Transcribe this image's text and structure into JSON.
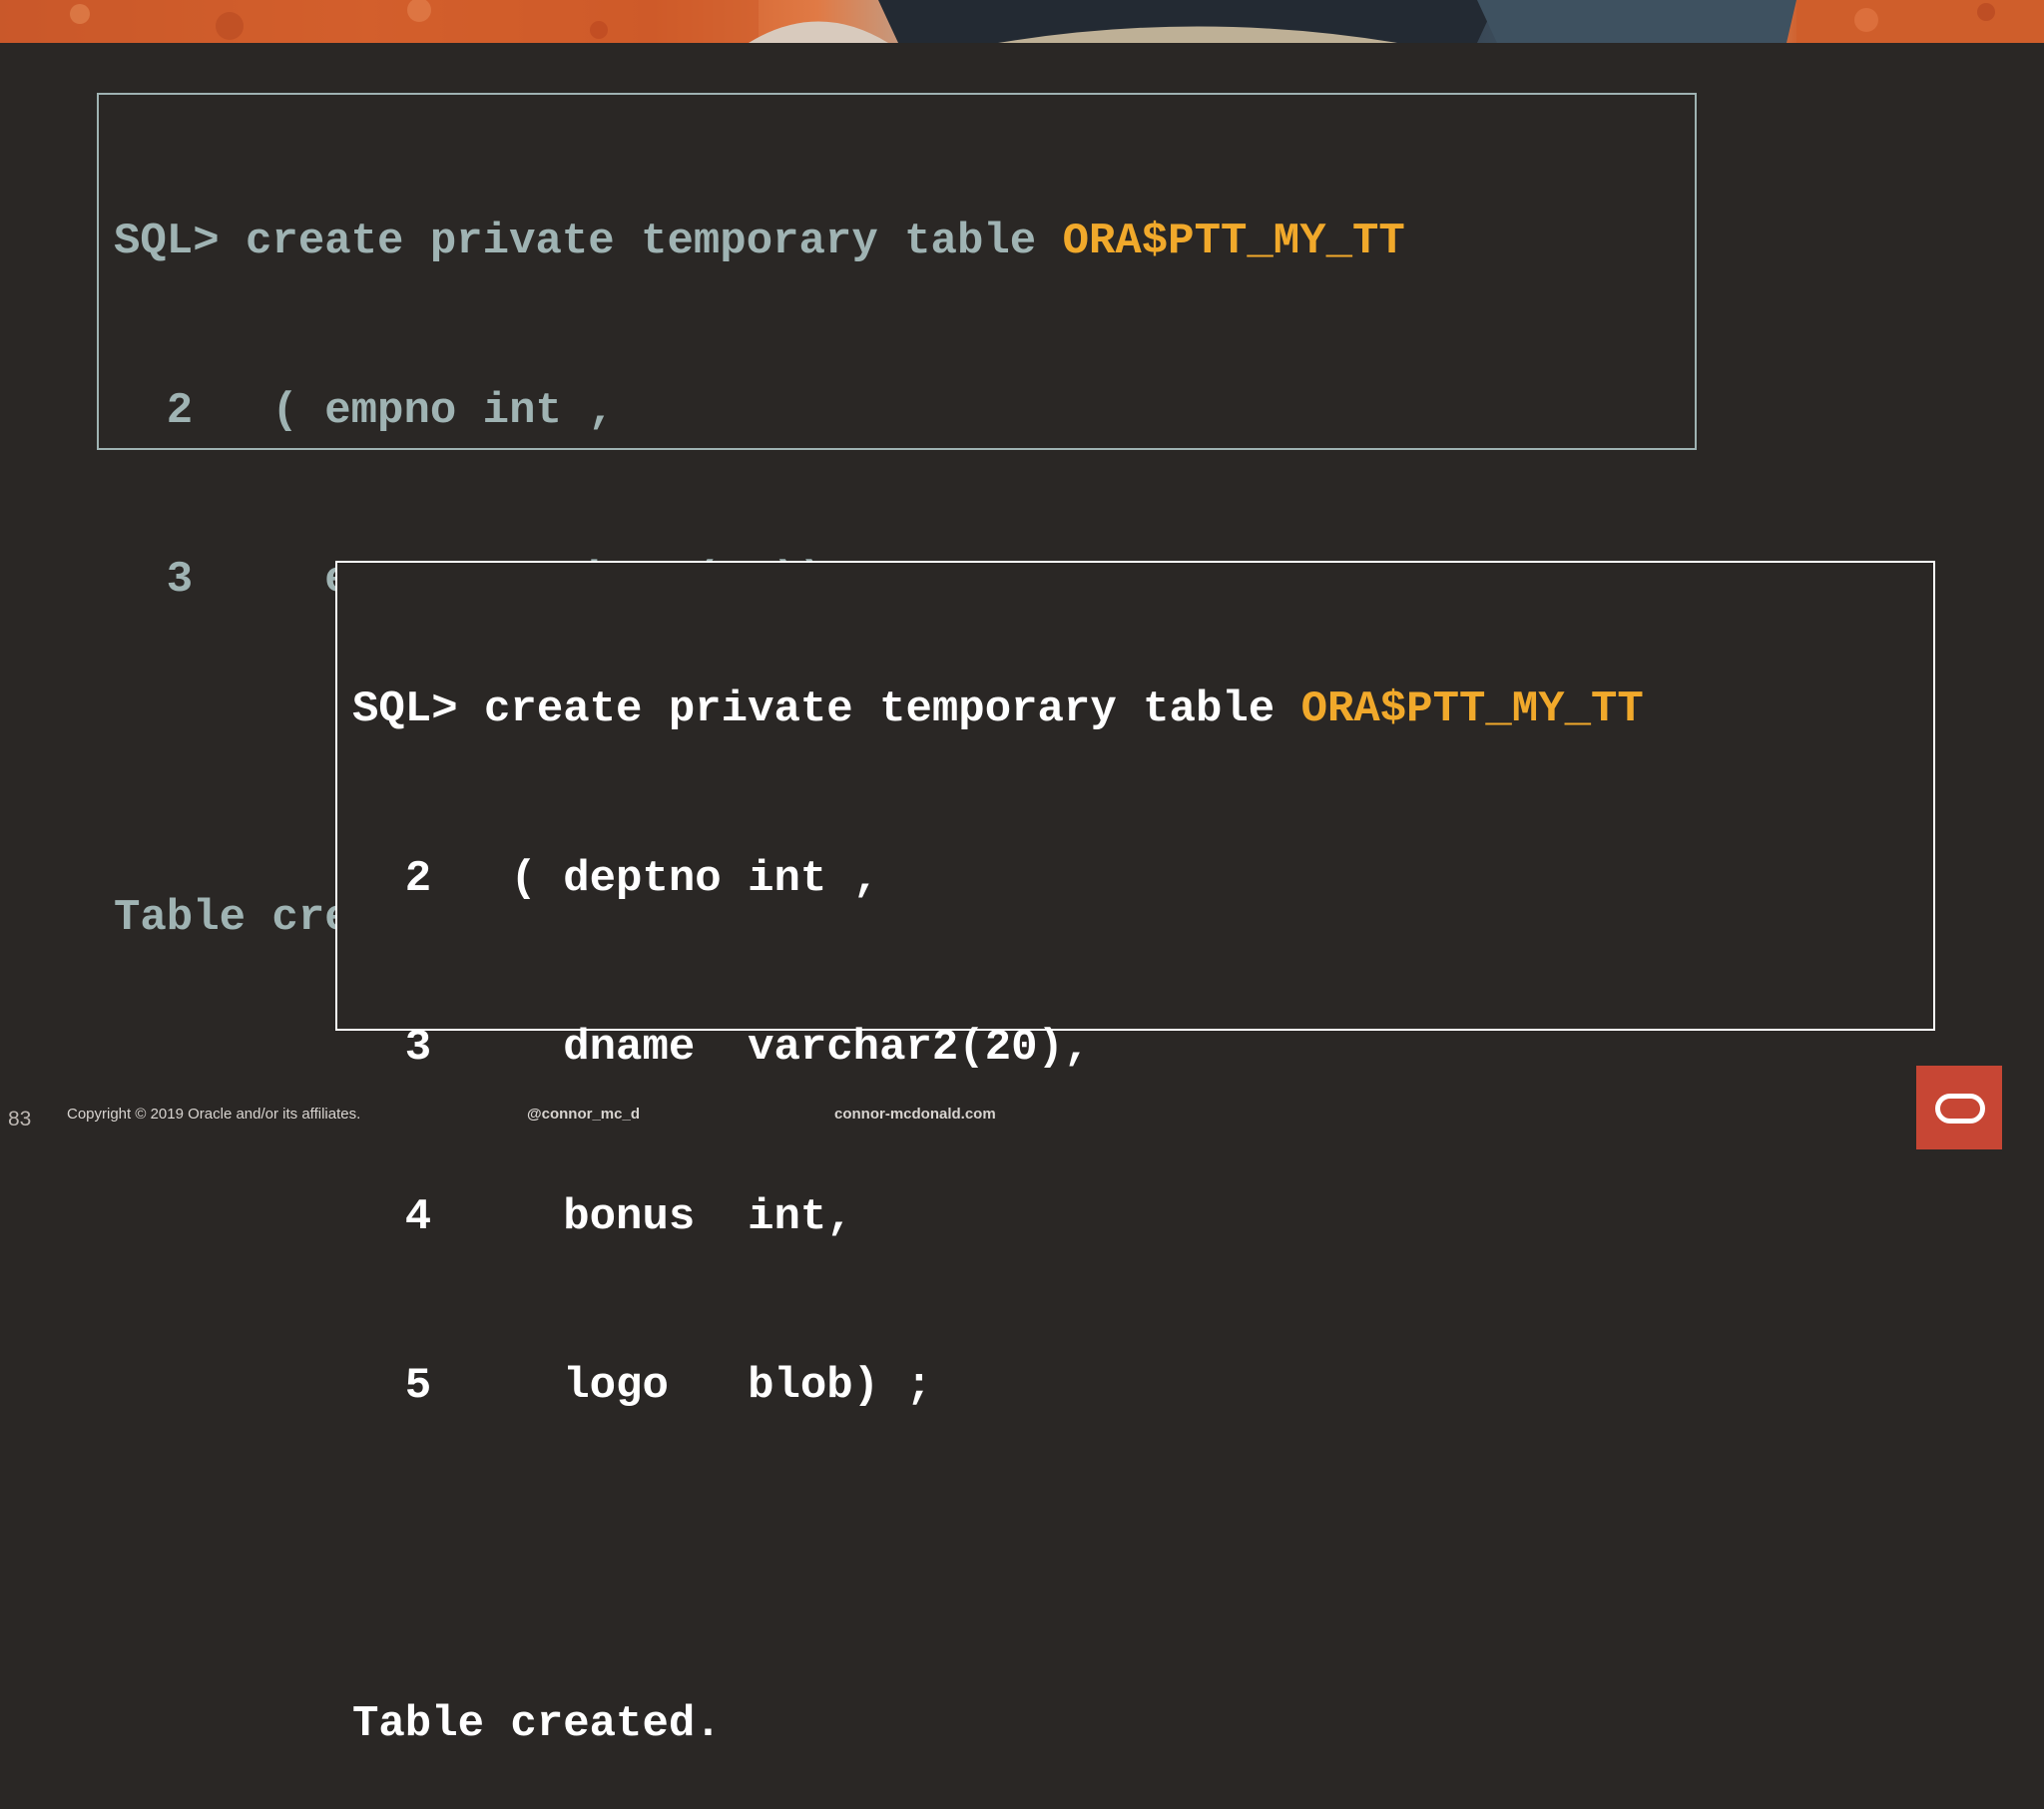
{
  "slide": {
    "page_number": "83",
    "copyright": "Copyright © 2019 Oracle and/or its affiliates.",
    "twitter": "@connor_mc_d",
    "website": "connor-mcdonald.com"
  },
  "top_listing": {
    "lines": [
      {
        "text": "SQL> create private temporary table ",
        "highlight": "ORA$PTT_MY_TT"
      },
      {
        "text": "  2   ( empno int ,",
        "highlight": ""
      },
      {
        "text": "  3     ename varchar2(20)) ;",
        "highlight": ""
      },
      {
        "text": "",
        "highlight": ""
      },
      {
        "text": "Table created.",
        "highlight": ""
      }
    ]
  },
  "bottom_listing": {
    "lines": [
      {
        "text": "SQL> create private temporary table ",
        "highlight": "ORA$PTT_MY_TT"
      },
      {
        "text": "  2   ( deptno int ,",
        "highlight": ""
      },
      {
        "text": "  3     dname  varchar2(20),",
        "highlight": ""
      },
      {
        "text": "  4     bonus  int,",
        "highlight": ""
      },
      {
        "text": "  5     logo   blob) ;",
        "highlight": ""
      },
      {
        "text": "",
        "highlight": ""
      },
      {
        "text": "Table created.",
        "highlight": ""
      }
    ]
  },
  "colors": {
    "background": "#2a2725",
    "top_text": "#9fb3b3",
    "bottom_text": "#ffffff",
    "highlight": "#f1a92b",
    "oracle_red": "#c74634"
  },
  "icons": {
    "oracle_logo": "oracle-logo-icon"
  }
}
